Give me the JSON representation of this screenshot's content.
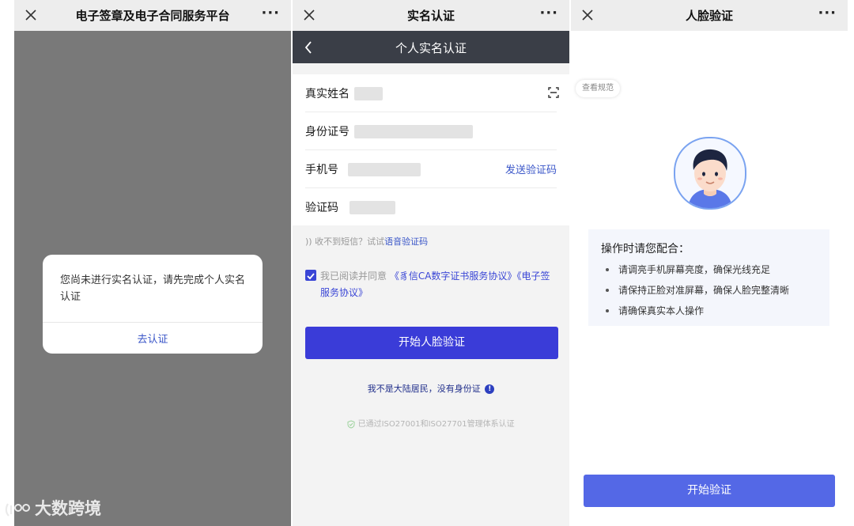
{
  "panel1": {
    "title": "电子签章及电子合同服务平台",
    "close_icon": "close-icon",
    "more_label": "···",
    "dialog": {
      "message": "您尚未进行实名认证，请先完成个人实名认证",
      "action_label": "去认证"
    }
  },
  "panel2": {
    "title": "实名认证",
    "more_label": "···",
    "header_title": "个人实名认证",
    "fields": {
      "name_label": "真实姓名",
      "id_label": "身份证号",
      "phone_label": "手机号",
      "send_code_label": "发送验证码",
      "code_label": "验证码"
    },
    "voice_hint_prefix": "收不到短信？试试",
    "voice_hint_link": "语音验证码",
    "agreement_prefix": "我已阅读并同意",
    "agreement_link1": "《豸信CA数字证书服务协议》",
    "agreement_link2": "《电子签服务协议》",
    "agreement_checked": true,
    "primary_button": "开始人脸验证",
    "non_resident": "我不是大陆居民，没有身份证",
    "iso_text": "已通过ISO27001和ISO27701管理体系认证"
  },
  "panel3": {
    "title": "人脸验证",
    "more_label": "···",
    "spec_button": "查看规范",
    "tips_title": "操作时请您配合：",
    "tips": [
      "请调亮手机屏幕亮度，确保光线充足",
      "请保持正脸对准屏幕，确保人脸完整清晰",
      "请确保真实本人操作"
    ],
    "start_button": "开始验证"
  },
  "watermark": "大数跨境",
  "colors": {
    "accent": "#3a3cd8",
    "link": "#3a56c8",
    "dark_header": "#3a3e47",
    "overlay": "#797979"
  }
}
